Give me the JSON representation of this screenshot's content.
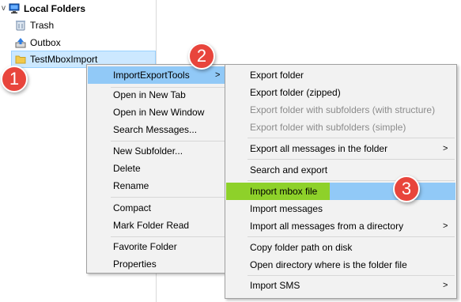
{
  "folder_tree": {
    "root_label": "Local Folders",
    "items": [
      {
        "label": "Trash",
        "icon": "trash-icon"
      },
      {
        "label": "Outbox",
        "icon": "outbox-icon"
      },
      {
        "label": "TestMboxImport",
        "icon": "folder-icon",
        "selected": true
      }
    ]
  },
  "context_menu": {
    "items": [
      {
        "label": "ImportExportTools",
        "submenu": true,
        "highlighted": true
      },
      {
        "label": "Open in New Tab"
      },
      {
        "label": "Open in New Window"
      },
      {
        "label": "Search Messages..."
      },
      {
        "label": "New Subfolder..."
      },
      {
        "label": "Delete"
      },
      {
        "label": "Rename"
      },
      {
        "label": "Compact"
      },
      {
        "label": "Mark Folder Read"
      },
      {
        "label": "Favorite Folder"
      },
      {
        "label": "Properties"
      }
    ]
  },
  "submenu": {
    "items": [
      {
        "label": "Export folder"
      },
      {
        "label": "Export folder (zipped)"
      },
      {
        "label": "Export folder with subfolders (with structure)",
        "disabled": true
      },
      {
        "label": "Export folder with subfolders (simple)",
        "disabled": true
      },
      {
        "label": "Export all messages in the folder",
        "submenu": true
      },
      {
        "label": "Search and export"
      },
      {
        "label": "Import mbox file",
        "highlighted": true
      },
      {
        "label": "Import messages"
      },
      {
        "label": "Import all messages from a directory",
        "submenu": true
      },
      {
        "label": "Copy folder path on disk"
      },
      {
        "label": "Open directory where is the folder file"
      },
      {
        "label": "Import SMS",
        "submenu": true
      }
    ]
  },
  "badges": {
    "one": "1",
    "two": "2",
    "three": "3"
  },
  "glyphs": {
    "submenu_arrow": ">",
    "chevron": "v"
  },
  "colors": {
    "selection": "#cce8ff",
    "menu_hover": "#91c9f7",
    "mbox_highlight": "#8ed12a",
    "badge": "#e8453c"
  }
}
